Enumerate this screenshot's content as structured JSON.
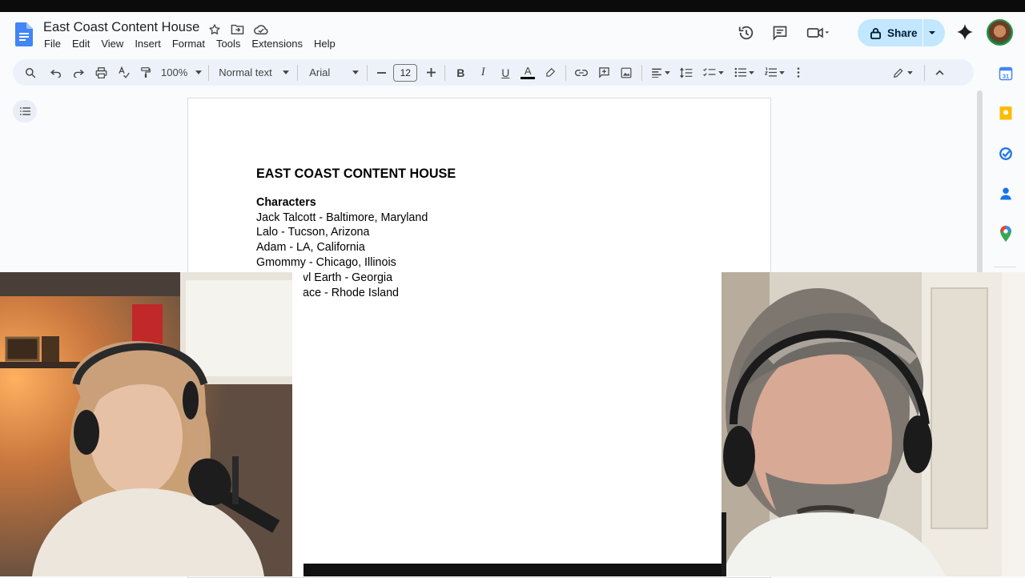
{
  "doc": {
    "title": "East Coast Content House",
    "menu": [
      "File",
      "Edit",
      "View",
      "Insert",
      "Format",
      "Tools",
      "Extensions",
      "Help"
    ]
  },
  "header": {
    "share_label": "Share"
  },
  "toolbar": {
    "zoom": "100%",
    "style": "Normal text",
    "font": "Arial",
    "font_size": "12"
  },
  "body": {
    "heading": "EAST COAST CONTENT HOUSE",
    "section": "Characters",
    "lines": [
      "Jack Talcott - Baltimore, Maryland",
      "Lalo - Tucson, Arizona",
      "Adam - LA, California",
      "Gmommy - Chicago, Illinois",
      "vl Earth - Georgia",
      "ace - Rhode Island"
    ]
  },
  "colors": {
    "docs_blue": "#4285f4",
    "share_bg": "#c2e7ff",
    "toolbar_bg": "#edf2fa",
    "page_bg": "#f9fbfd"
  },
  "icons": [
    "docs-logo-icon",
    "star-icon",
    "move-folder-icon",
    "cloud-status-icon",
    "version-history-icon",
    "comments-icon",
    "meet-icon",
    "lock-icon",
    "gemini-icon",
    "search-menus-icon",
    "undo-icon",
    "redo-icon",
    "print-icon",
    "spellcheck-icon",
    "paint-format-icon",
    "text-color-icon",
    "highlight-icon",
    "link-icon",
    "add-comment-icon",
    "insert-image-icon",
    "align-icon",
    "line-spacing-icon",
    "checklist-icon",
    "bullet-list-icon",
    "numbered-list-icon",
    "more-icon",
    "editing-mode-icon",
    "collapse-icon",
    "outline-icon",
    "calendar-icon",
    "keep-icon",
    "tasks-icon",
    "contacts-icon",
    "maps-icon"
  ]
}
